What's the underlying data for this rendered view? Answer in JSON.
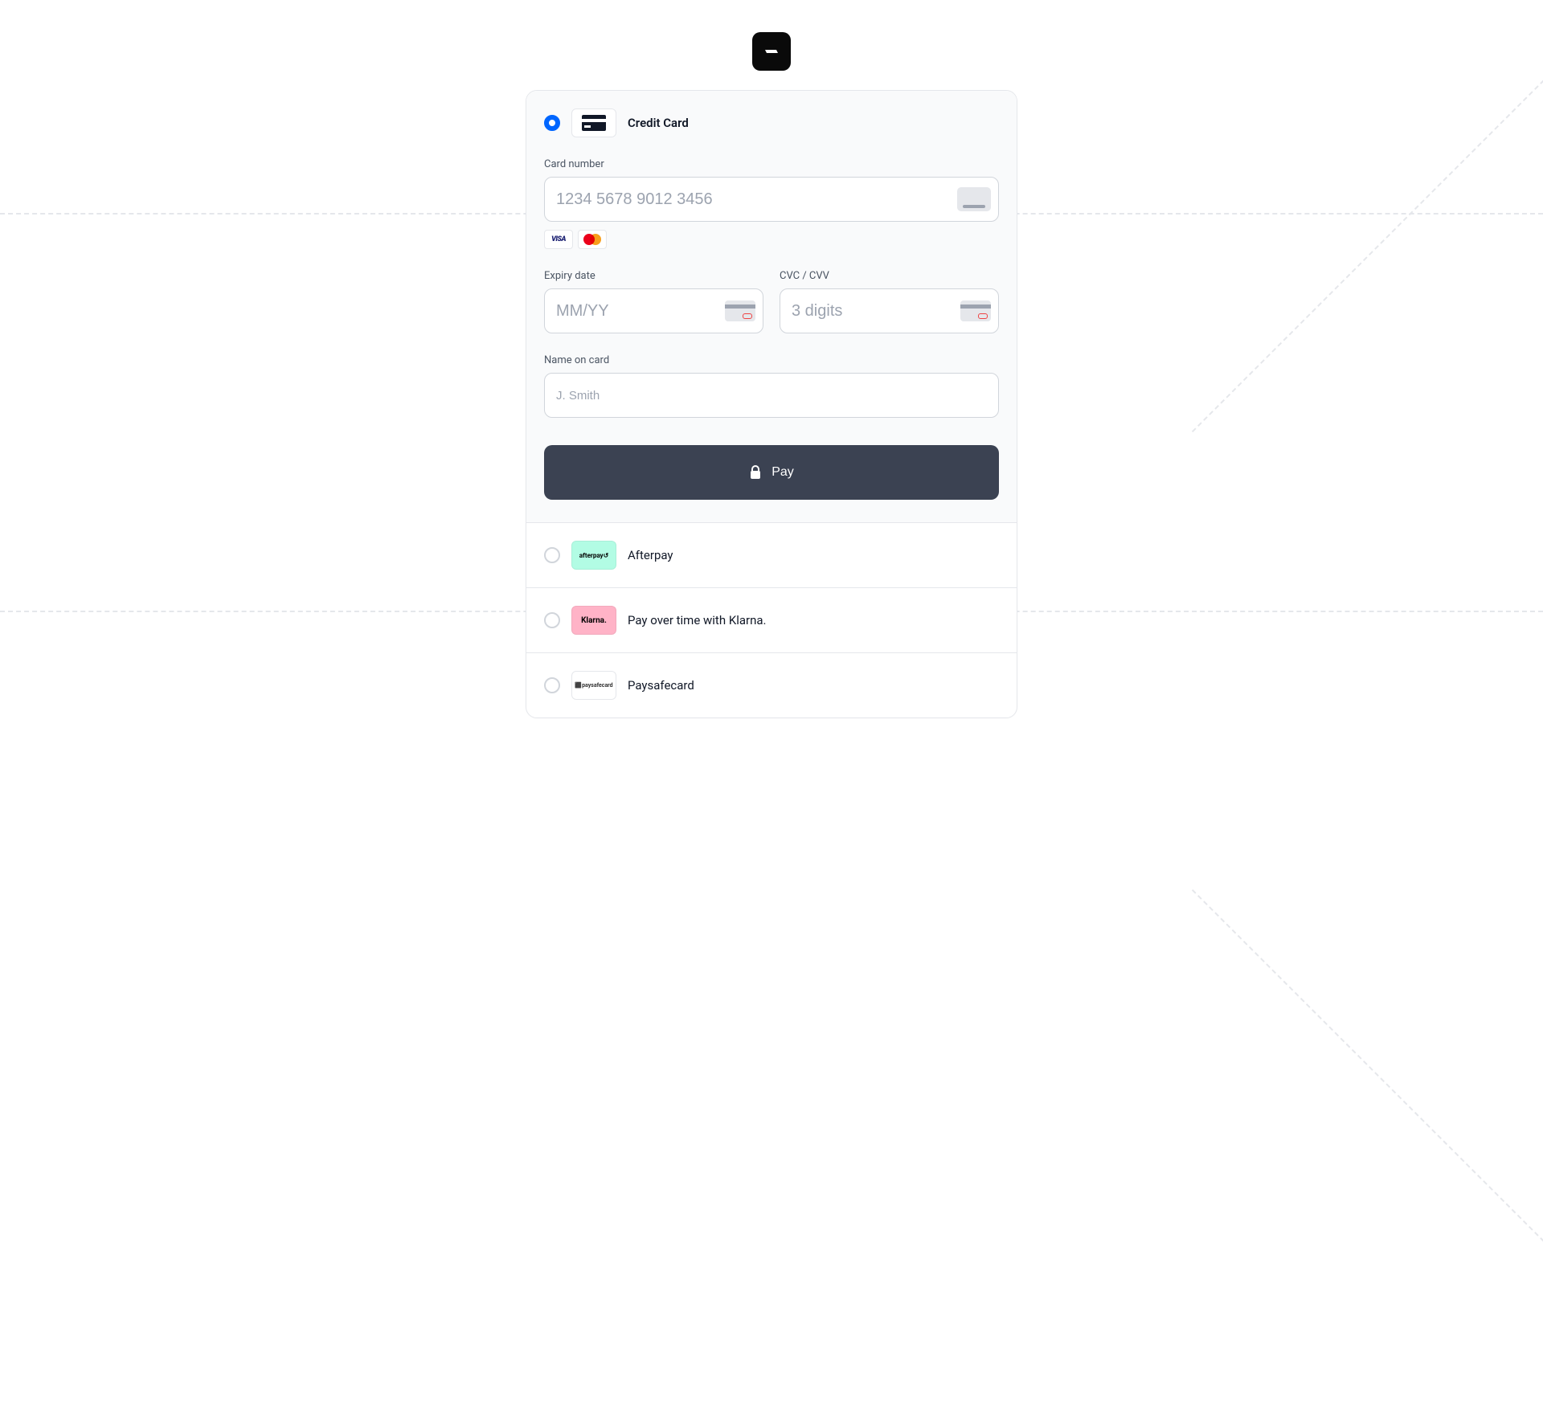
{
  "methods": {
    "credit_card": {
      "label": "Credit Card"
    },
    "afterpay": {
      "label": "Afterpay",
      "chip_text": "afterpay↺"
    },
    "klarna": {
      "label": "Pay over time with Klarna.",
      "chip_text": "Klarna."
    },
    "paysafe": {
      "label": "Paysafecard",
      "chip_text": "⬛paysafecard"
    }
  },
  "fields": {
    "card_number": {
      "label": "Card number",
      "placeholder": "1234 5678 9012 3456"
    },
    "expiry": {
      "label": "Expiry date",
      "placeholder": "MM/YY"
    },
    "cvc": {
      "label": "CVC / CVV",
      "placeholder": "3 digits"
    },
    "name": {
      "label": "Name on card",
      "placeholder": "J. Smith"
    }
  },
  "brands": {
    "visa": "VISA",
    "mastercard": "mastercard"
  },
  "buttons": {
    "pay": "Pay"
  }
}
